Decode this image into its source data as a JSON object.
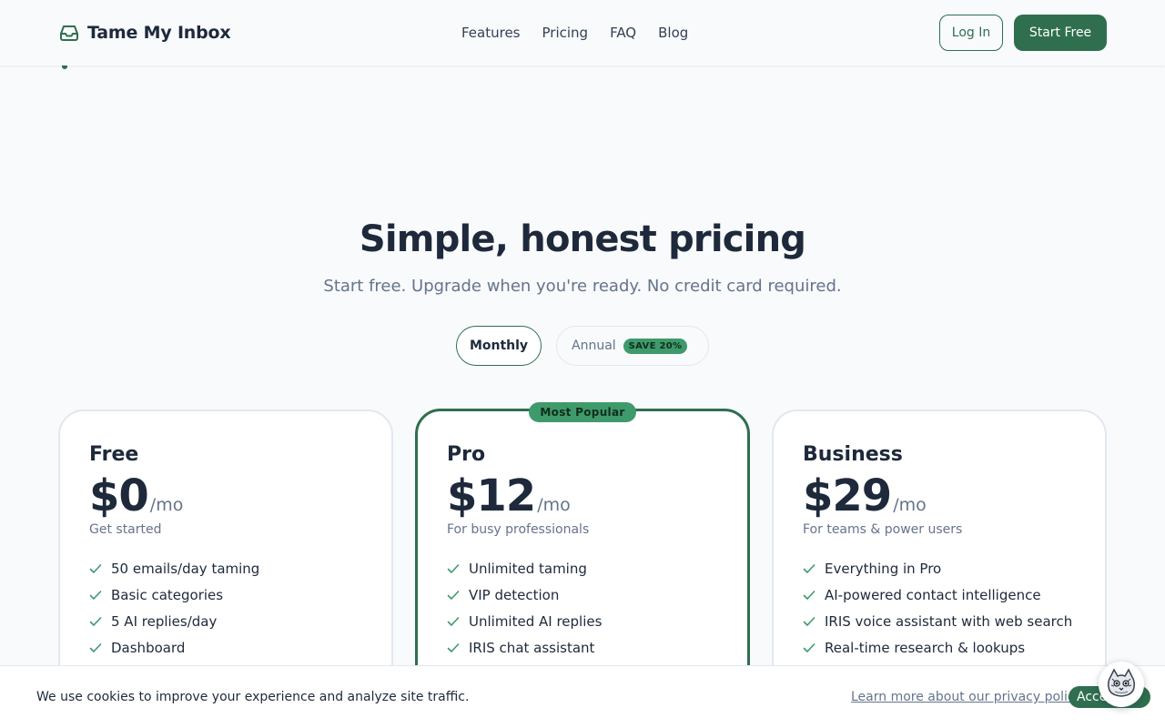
{
  "brand": {
    "name": "Tame My Inbox",
    "icon": "inbox-icon"
  },
  "nav": {
    "items": [
      "Features",
      "Pricing",
      "FAQ",
      "Blog"
    ]
  },
  "header_actions": {
    "login_label": "Log In",
    "start_label": "Start Free"
  },
  "colors": {
    "accent": "#2f6f4f",
    "badge": "#3f9a6b",
    "text": "#1e293b",
    "muted": "#64748b"
  },
  "pricing": {
    "title": "Simple, honest pricing",
    "subtitle": "Start free. Upgrade when you're ready. No credit card required.",
    "toggle": {
      "monthly": "Monthly",
      "annual": "Annual",
      "save_badge": "SAVE 20%",
      "selected": "Monthly"
    },
    "plans": [
      {
        "name": "Free",
        "price": "$0",
        "period": "/mo",
        "tagline": "Get started",
        "features": [
          "50 emails/day taming",
          "Basic categories",
          "5 AI replies/day",
          "Dashboard"
        ]
      },
      {
        "name": "Pro",
        "price": "$12",
        "period": "/mo",
        "tagline": "For busy professionals",
        "badge": "Most Popular",
        "features": [
          "Unlimited taming",
          "VIP detection",
          "Unlimited AI replies",
          "IRIS chat assistant"
        ]
      },
      {
        "name": "Business",
        "price": "$29",
        "period": "/mo",
        "tagline": "For teams & power users",
        "features": [
          "Everything in Pro",
          "AI-powered contact intelligence",
          "IRIS voice assistant with web search",
          "Real-time research & lookups"
        ]
      }
    ]
  },
  "cookie_banner": {
    "text": "We use cookies to improve your experience and analyze site traffic.",
    "link": "Learn more about our privacy policy",
    "accept": "Accept"
  },
  "mascot": {
    "icon": "cat-mascot-icon"
  }
}
